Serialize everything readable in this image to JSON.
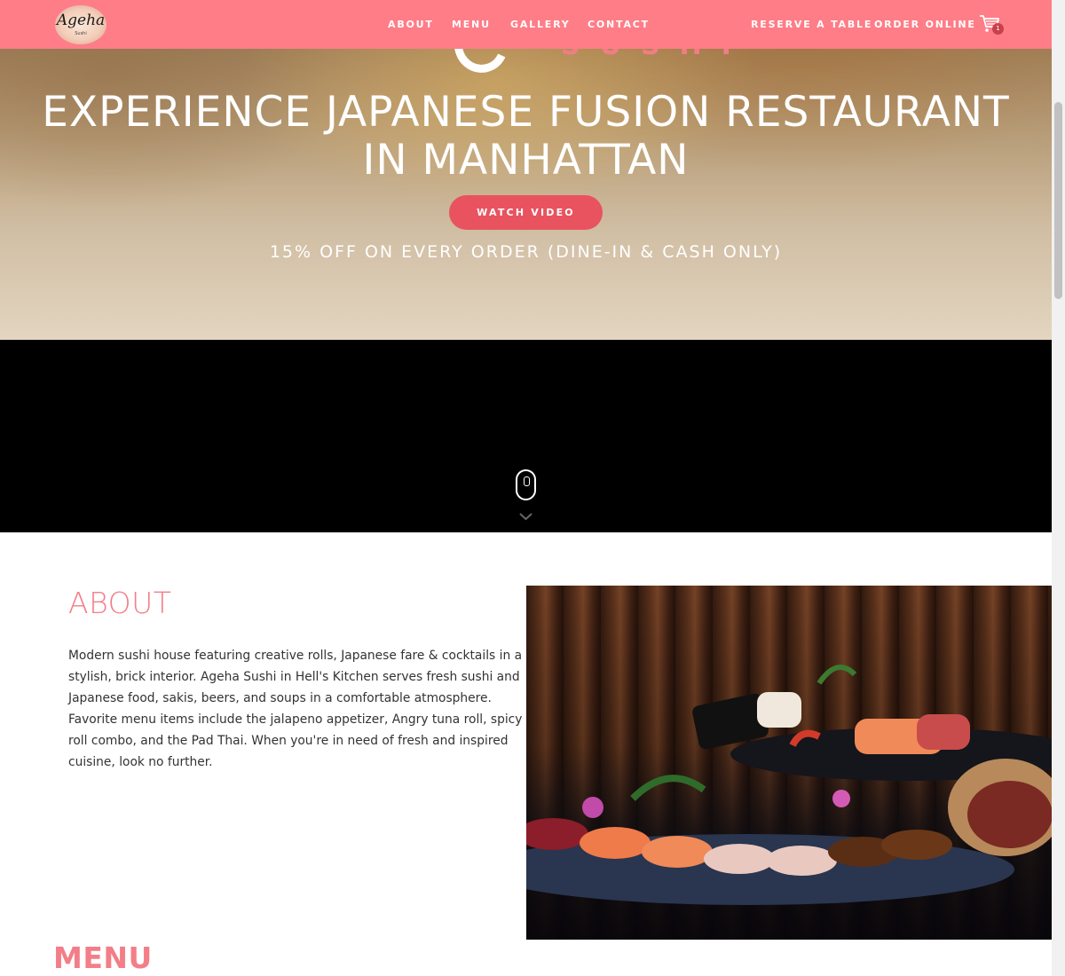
{
  "nav": {
    "logo_text": "Ageha",
    "logo_sub": "Sushi",
    "links": [
      "ABOUT",
      "MENU",
      "GALLERY",
      "CONTACT"
    ],
    "reserve_label": "RESERVE A TABLE",
    "order_label": "ORDER ONLINE",
    "cart_count": "1",
    "cart_icon": "shopping-cart-icon",
    "background_color": "#fe7d87"
  },
  "hero": {
    "logo_word": "SUSHI",
    "title_line1": "EXPERIENCE JAPANESE FUSION RESTAURANT",
    "title_line2": "IN MANHATTAN",
    "watch_label": "WATCH VIDEO",
    "promo": "15% OFF ON EVERY ORDER (DINE-IN & CASH ONLY)",
    "button_color": "#e8535f"
  },
  "scroll_hint": {
    "mouse_icon": "mouse-icon",
    "chevron_icon": "chevron-down-icon"
  },
  "about": {
    "title": "ABOUT",
    "text": "Modern sushi house featuring creative rolls, Japanese fare & cocktails in a stylish, brick interior. Ageha Sushi in Hell's Kitchen serves fresh sushi and Japanese food, sakis, beers, and soups in a comfortable atmosphere. Favorite menu items include the jalapeno appetizer, Angry tuna roll, spicy roll combo, and the Pad Thai. When you're in need of fresh and inspired cuisine, look no further.",
    "accent_color": "#f37e88"
  },
  "menu": {
    "title": "MENU"
  }
}
